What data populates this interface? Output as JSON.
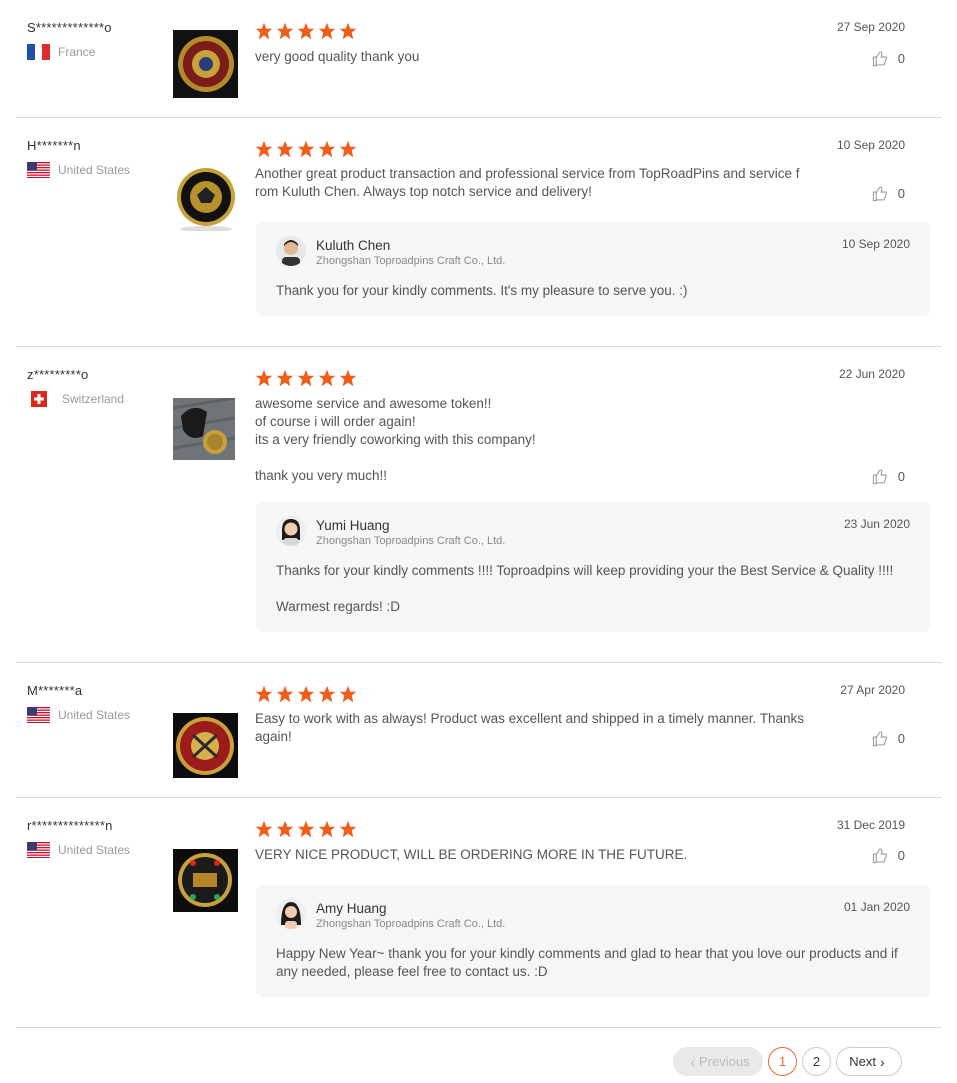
{
  "reviews": [
    {
      "buyer": "S*************o",
      "country": "France",
      "date": "27 Sep 2020",
      "text": "very good quality thank you",
      "likes": "0",
      "rating": 5
    },
    {
      "buyer": "H*******n",
      "country": "United States",
      "date": "10 Sep 2020",
      "text": "Another great product transaction and professional service from TopRoadPins and service f\nrom Kuluth Chen.  Always top notch service and delivery!",
      "likes": "0",
      "rating": 5,
      "reply": {
        "name": "Kuluth Chen",
        "company": "Zhongshan Toproadpins Craft Co., Ltd.",
        "date": "10 Sep 2020",
        "text": "Thank you for your kindly comments. It's my pleasure to serve you. :)"
      }
    },
    {
      "buyer": "z*********o",
      "country": "Switzerland",
      "date": "22 Jun 2020",
      "text": "awesome service and awesome token!!\nof course i will order again!\nits a very friendly coworking with this company!\n\nthank you very much!!",
      "likes": "0",
      "rating": 5,
      "reply": {
        "name": "Yumi Huang",
        "company": "Zhongshan Toproadpins Craft Co., Ltd.",
        "date": "23 Jun 2020",
        "text": "Thanks for your kindly comments !!!! Toproadpins will keep providing your the Best Service & Quality !!!!\n\nWarmest regards! :D"
      }
    },
    {
      "buyer": "M*******a",
      "country": "United States",
      "date": "27 Apr 2020",
      "text": "Easy to work with as always! Product was excellent and shipped in a timely manner. Thanks\nagain!",
      "likes": "0",
      "rating": 5
    },
    {
      "buyer": "r**************n",
      "country": "United States",
      "date": "31 Dec 2019",
      "text": "VERY NICE PRODUCT, WILL BE ORDERING MORE IN THE FUTURE.",
      "likes": "0",
      "rating": 5,
      "reply": {
        "name": "Amy Huang",
        "company": "Zhongshan Toproadpins Craft Co., Ltd.",
        "date": "01 Jan 2020",
        "text": "Happy New Year~ thank you for your kindly comments and glad to hear that you love our products and if\nany needed, please feel free to contact us. :D"
      }
    }
  ],
  "pagination": {
    "previous": "Previous",
    "pages": [
      "1",
      "2"
    ],
    "current": "1",
    "next": "Next"
  },
  "colors": {
    "star": "#f25c19",
    "active_page": "#e86b2c",
    "reply_bg": "#f5f6f8"
  }
}
